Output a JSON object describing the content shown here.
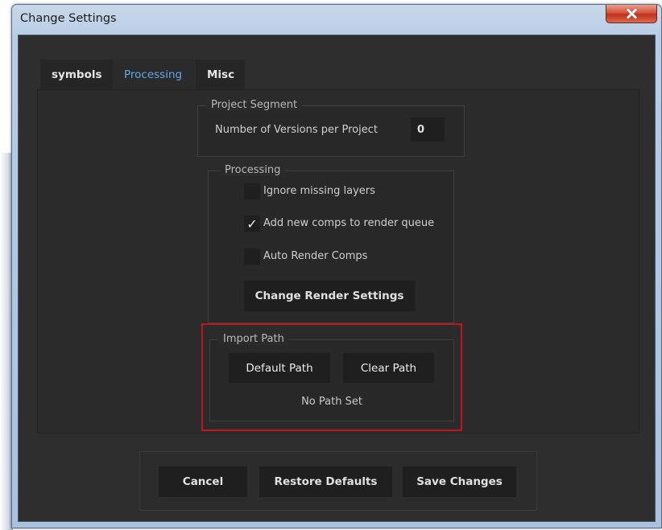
{
  "window": {
    "title": "Change Settings",
    "close_icon": "close-icon"
  },
  "tabs": [
    {
      "label": "symbols",
      "active": false
    },
    {
      "label": "Processing",
      "active": true
    },
    {
      "label": "Misc",
      "active": false
    }
  ],
  "project_segment": {
    "title": "Project Segment",
    "versions_label": "Number of Versions per Project",
    "versions_value": "0"
  },
  "processing": {
    "title": "Processing",
    "options": [
      {
        "label": "Ignore missing layers",
        "checked": false
      },
      {
        "label": "Add new comps to render queue",
        "checked": true
      },
      {
        "label": "Auto Render Comps",
        "checked": false
      }
    ],
    "change_render_label": "Change Render Settings",
    "check_mark": "✓"
  },
  "import_path": {
    "title": "Import Path",
    "default_label": "Default Path",
    "clear_label": "Clear Path",
    "status": "No Path Set"
  },
  "footer": {
    "cancel_label": "Cancel",
    "restore_label": "Restore Defaults",
    "save_label": "Save Changes"
  },
  "colors": {
    "accent_tab": "#5fa9e8",
    "highlight": "#c0161d",
    "background": "#2e2e2e"
  }
}
